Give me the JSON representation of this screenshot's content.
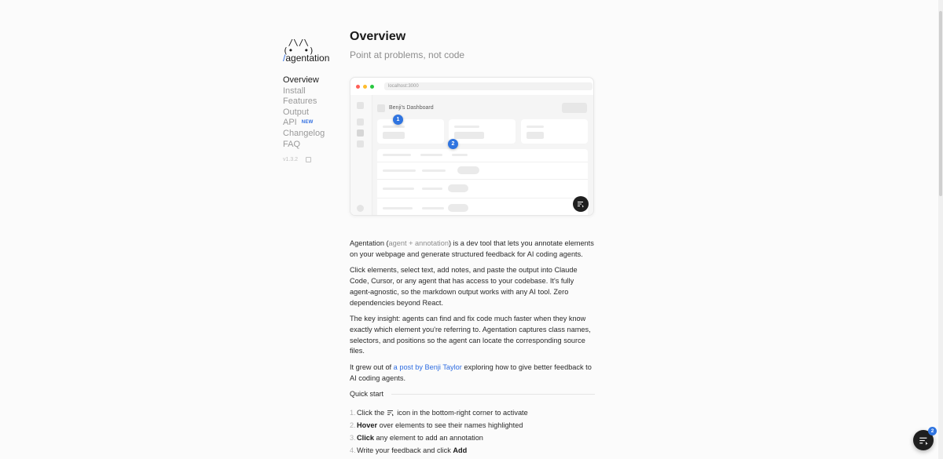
{
  "brand": {
    "logo": "(•  •)",
    "slash": "/",
    "name": "agentation"
  },
  "nav": {
    "items": [
      {
        "label": "Overview"
      },
      {
        "label": "Install"
      },
      {
        "label": "Features"
      },
      {
        "label": "Output"
      },
      {
        "label": "API",
        "badge": "NEW"
      },
      {
        "label": "Changelog"
      },
      {
        "label": "FAQ"
      }
    ],
    "version": "v1.3.2"
  },
  "page": {
    "title": "Overview",
    "subtitle": "Point at problems, not code"
  },
  "preview": {
    "url": "localhost:3000",
    "dashboard_title": "Benji's Dashboard",
    "markers": [
      "1",
      "2"
    ]
  },
  "body": {
    "p1": {
      "a": "Agentation (",
      "muted": "agent + annotation",
      "b": ") is a dev tool that lets you annotate elements on your webpage and generate structured feedback for AI coding agents."
    },
    "p2": "Click elements, select text, add notes, and paste the output into Claude Code, Cursor, or any agent that has access to your codebase. It's fully agent-agnostic, so the markdown output works with any AI tool. Zero dependencies beyond React.",
    "p3": "The key insight: agents can find and fix code much faster when they know exactly which element you're referring to. Agentation captures class names, selectors, and positions so the agent can locate the corresponding source files.",
    "p4": {
      "a": "It grew out of ",
      "link": "a post by Benji Taylor",
      "b": " exploring how to give better feedback to AI coding agents."
    }
  },
  "quickstart": {
    "heading": "Quick start",
    "steps": [
      {
        "num": "1.",
        "a": "Click the",
        "b": "icon in the bottom-right corner to activate"
      },
      {
        "num": "2.",
        "bold": "Hover",
        "rest": " over elements to see their names highlighted"
      },
      {
        "num": "3.",
        "bold": "Click",
        "rest": " any element to add an annotation"
      },
      {
        "num": "4.",
        "a": "Write your feedback and click ",
        "bold": "Add"
      }
    ]
  },
  "toolbar": {
    "badge_count": "2"
  },
  "colors": {
    "accent": "#2f74e0",
    "link": "#2f6de1",
    "fab": "#1f1f1f"
  }
}
